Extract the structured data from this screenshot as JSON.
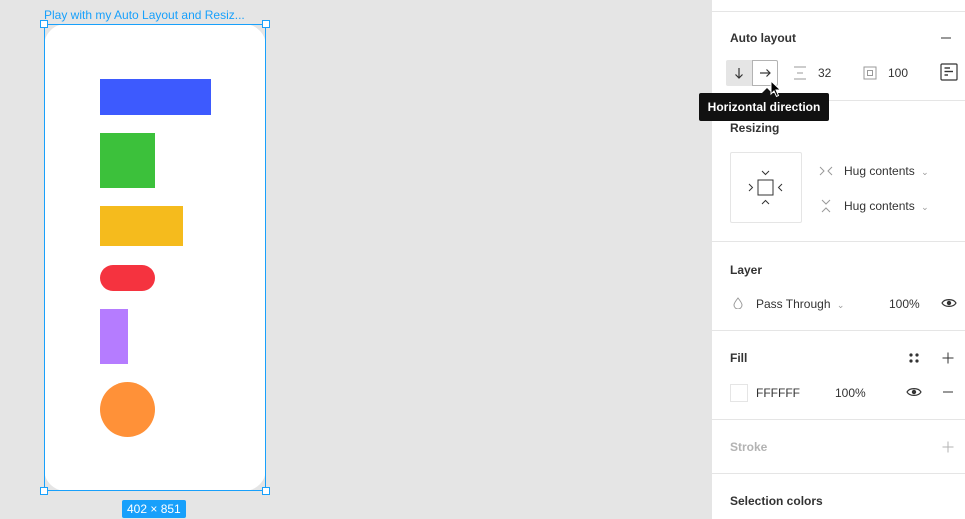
{
  "canvas": {
    "frame_label": "Play with my Auto Layout and Resiz...",
    "size_badge": "402 × 851",
    "shapes": [
      {
        "name": "blue-rectangle",
        "color": "#3d5afe"
      },
      {
        "name": "green-square",
        "color": "#3cc13b"
      },
      {
        "name": "yellow-rectangle",
        "color": "#f5bb1d"
      },
      {
        "name": "red-pill",
        "color": "#f5333f"
      },
      {
        "name": "purple-rectangle",
        "color": "#b57cff"
      },
      {
        "name": "orange-circle",
        "color": "#ff9138"
      }
    ]
  },
  "panel": {
    "auto_layout": {
      "title": "Auto layout",
      "spacing": "32",
      "padding": "100",
      "tooltip": "Horizontal direction",
      "icons": [
        "arrow-down-icon",
        "arrow-right-icon",
        "spacing-icon",
        "padding-icon",
        "alignment-icon",
        "minus-icon"
      ]
    },
    "resizing": {
      "title": "Resizing",
      "horizontal": "Hug contents",
      "vertical": "Hug contents"
    },
    "layer": {
      "title": "Layer",
      "blend_mode": "Pass Through",
      "opacity": "100%"
    },
    "fill": {
      "title": "Fill",
      "hex": "FFFFFF",
      "opacity": "100%",
      "swatch_color": "#ffffff"
    },
    "stroke": {
      "title": "Stroke"
    },
    "selection_colors": {
      "title": "Selection colors"
    }
  },
  "colors": {
    "accent": "#18a0fb"
  }
}
